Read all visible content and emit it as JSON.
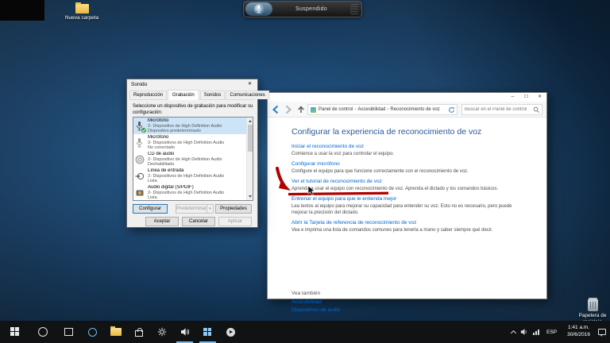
{
  "desktop": {
    "new_folder_label": "Nueva carpeta",
    "recycle_bin_label": "Papelera de reciclaje"
  },
  "speech_widget": {
    "status": "Suspendido"
  },
  "sound_dialog": {
    "title": "Sonido",
    "tabs": [
      "Reproducción",
      "Grabación",
      "Sonidos",
      "Comunicaciones"
    ],
    "instruction": "Seleccione un dispositivo de grabación para modificar su configuración:",
    "devices": [
      {
        "name": "Micrófono",
        "detail": "2- Dispositivo de High Definition Audio",
        "status": "Dispositivo predeterminado"
      },
      {
        "name": "Micrófono",
        "detail": "3- Dispositivos de High Definition Audio",
        "status": "No conectado"
      },
      {
        "name": "CD de audio",
        "detail": "2- Dispositivo de High Definition Audio",
        "status": "Deshabilitado"
      },
      {
        "name": "Línea de entrada",
        "detail": "2- Dispositivos de High Definition Audio",
        "status": "Lista"
      },
      {
        "name": "Audio digital (S/PDIF)",
        "detail": "2- Dispositivos de High Definition Audio",
        "status": "Lista"
      }
    ],
    "buttons": {
      "configure": "Configurar",
      "set_default": "Predeterminar",
      "dropdown": "▾",
      "properties": "Propiedades",
      "ok": "Aceptar",
      "cancel": "Cancelar",
      "apply": "Aplicar"
    },
    "window_controls": {
      "close": "✕"
    }
  },
  "control_panel": {
    "window_controls": {
      "minimize": "─",
      "maximize": "☐",
      "close": "✕"
    },
    "breadcrumb": {
      "items": [
        "Panel de control",
        "Accesibilidad",
        "Reconocimiento de voz"
      ],
      "separator": "›"
    },
    "search_placeholder": "Buscar en el Panel de control",
    "page_title": "Configurar la experiencia de reconocimiento de voz",
    "tasks": [
      {
        "link": "Iniciar el reconocimiento de voz",
        "desc": "Comience a usar la voz para controlar el equipo."
      },
      {
        "link": "Configurar micrófono",
        "desc": "Configure el equipo para que funcione correctamente con el reconocimiento de voz."
      },
      {
        "link": "Ver el tutorial de reconocimiento de voz",
        "desc": "Aprenda a usar el equipo con reconocimiento de voz. Aprenda el dictado y los comandos básicos."
      },
      {
        "link": "Entrenar el equipo para que le entienda mejor",
        "desc": "Lea textos al equipo para mejorar su capacidad para entender su voz. Esto no es necesario, pero puede mejorar la precisión del dictado."
      },
      {
        "link": "Abrir la Tarjeta de referencia de reconocimiento de voz",
        "desc": "Vea e imprima una lista de comandos comunes para tenerla a mano y saber siempre qué decir."
      }
    ],
    "see_also": {
      "header": "Vea también",
      "links": [
        "Accesibilidad",
        "Dispositivos de audio"
      ]
    }
  },
  "taskbar": {
    "language": "ESP",
    "time": "1:41 a.m.",
    "date": "30/6/2016"
  },
  "colors": {
    "accent": "#0078d7",
    "link": "#0066cc",
    "annotation": "#b00000"
  }
}
